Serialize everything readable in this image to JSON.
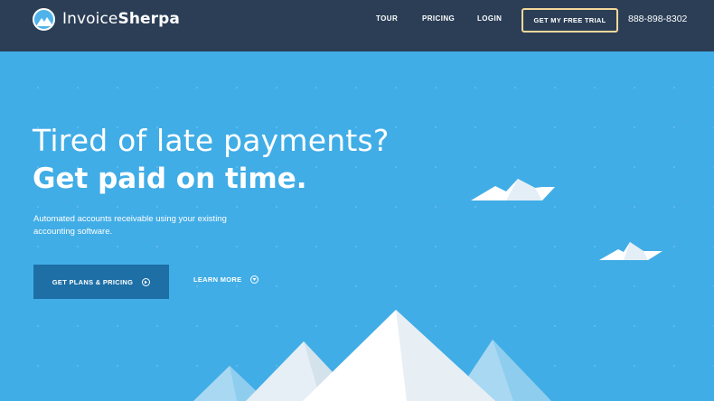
{
  "nav": {
    "logo_light": "Invoice",
    "logo_bold": "Sherpa",
    "links": [
      {
        "label": "TOUR"
      },
      {
        "label": "PRICING"
      },
      {
        "label": "LOGIN"
      }
    ],
    "cta_label": "GET MY FREE TRIAL",
    "phone": "888-898-8302"
  },
  "hero": {
    "headline_light": "Tired of late payments?",
    "headline_bold": "Get paid on time.",
    "subtext": "Automated accounts receivable using your existing accounting software.",
    "primary_button": "GET PLANS & PRICING",
    "secondary_button": "LEARN MORE"
  },
  "colors": {
    "nav_bg": "#2b3e56",
    "hero_bg": "#41ade6",
    "primary_button_bg": "#1d6fa6",
    "cta_border": "#f3d99a"
  },
  "icons": {
    "logo": "mountain-logo-icon",
    "primary_button": "arrow-right-circle-icon",
    "secondary_button": "chevron-down-circle-icon"
  }
}
